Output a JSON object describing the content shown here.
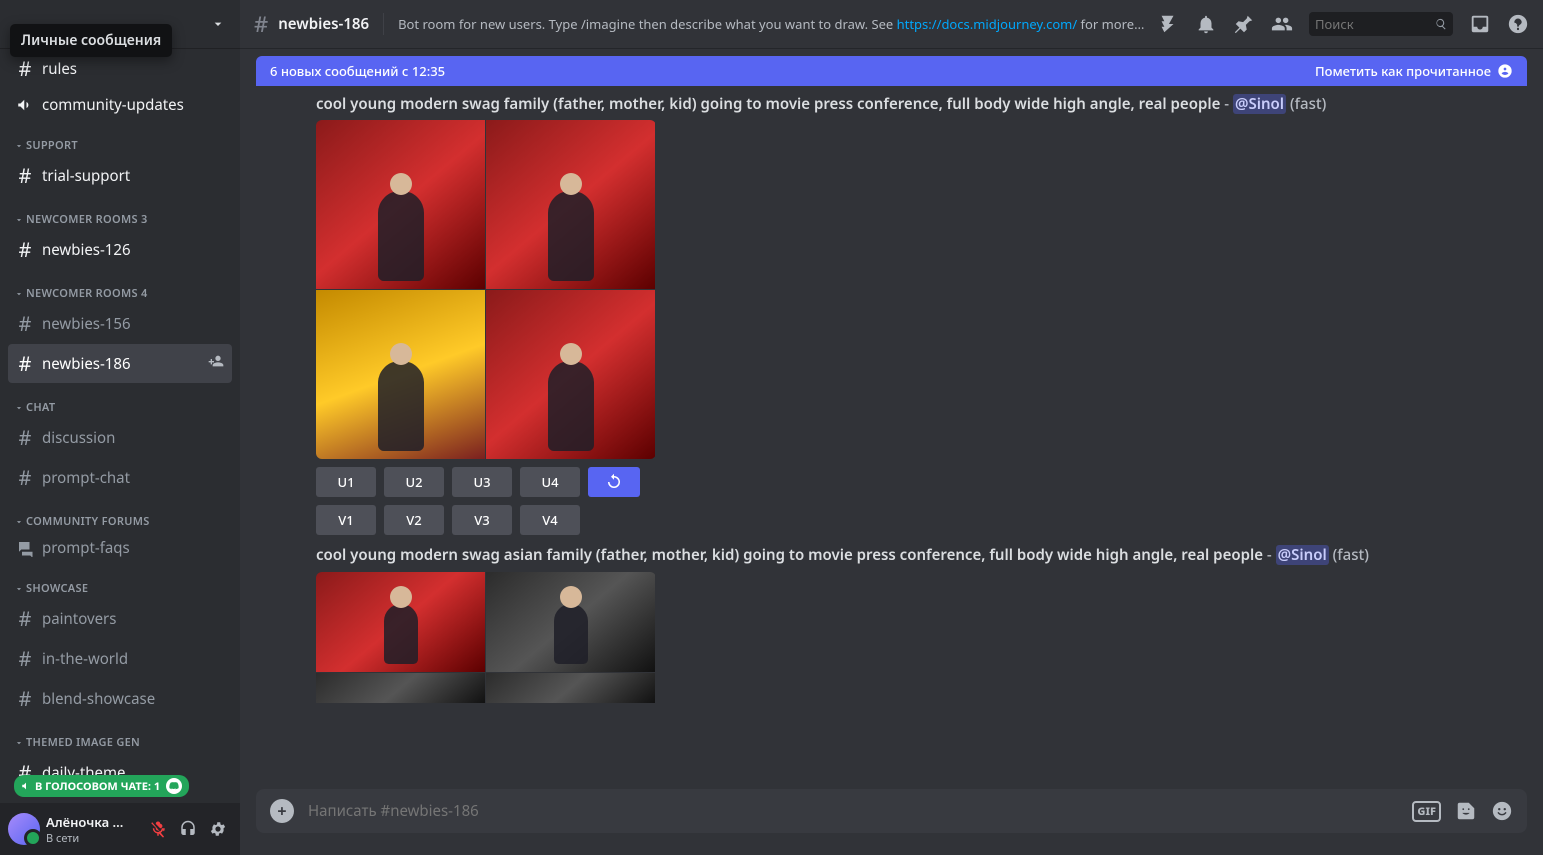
{
  "tooltip": "Личные сообщения",
  "sidebar": {
    "categories": [
      {
        "items": [
          {
            "label": "rules",
            "icon": "hash",
            "unread": true
          },
          {
            "label": "community-updates",
            "icon": "mega",
            "unread": true
          }
        ]
      },
      {
        "label": "SUPPORT",
        "items": [
          {
            "label": "trial-support",
            "icon": "hash",
            "unread": true
          }
        ]
      },
      {
        "label": "NEWCOMER ROOMS 3",
        "items": [
          {
            "label": "newbies-126",
            "icon": "hash",
            "unread": true
          }
        ]
      },
      {
        "label": "NEWCOMER ROOMS 4",
        "items": [
          {
            "label": "newbies-156",
            "icon": "hash"
          },
          {
            "label": "newbies-186",
            "icon": "hash",
            "sel": true,
            "add": true
          }
        ]
      },
      {
        "label": "CHAT",
        "items": [
          {
            "label": "discussion",
            "icon": "hash"
          },
          {
            "label": "prompt-chat",
            "icon": "hash"
          }
        ]
      },
      {
        "label": "COMMUNITY FORUMS",
        "items": [
          {
            "label": "prompt-faqs",
            "icon": "forum"
          }
        ]
      },
      {
        "label": "SHOWCASE",
        "items": [
          {
            "label": "paintovers",
            "icon": "hash"
          },
          {
            "label": "in-the-world",
            "icon": "hash"
          },
          {
            "label": "blend-showcase",
            "icon": "hash"
          }
        ]
      },
      {
        "label": "THEMED IMAGE GEN",
        "items": [
          {
            "label": "daily-theme",
            "icon": "hash",
            "unread": true
          }
        ]
      }
    ]
  },
  "voice_badge": "В ГОЛОСОВОМ ЧАТЕ: 1",
  "user": {
    "name": "Алёночка ...",
    "status": "В сети"
  },
  "header": {
    "channel": "newbies-186",
    "topic_pre": "Bot room for new users. Type /imagine then describe what you want to draw. See ",
    "topic_link": "https://docs.midjourney.com/",
    "topic_post": " for more i...",
    "search_placeholder": "Поиск"
  },
  "newbar": {
    "text": "6 новых сообщений с 12:35",
    "mark": "Пометить как прочитанное"
  },
  "messages": [
    {
      "prompt": "cool young modern swag family (father, mother, kid) going to movie press conference, full body wide high angle, real people",
      "mention": "@Sinol",
      "meta": "(fast)",
      "buttons_u": [
        "U1",
        "U2",
        "U3",
        "U4"
      ],
      "buttons_v": [
        "V1",
        "V2",
        "V3",
        "V4"
      ]
    },
    {
      "prompt": "cool young modern swag asian family (father, mother, kid) going to movie press conference, full body wide high angle, real people",
      "mention": "@Sinol",
      "meta": "(fast)"
    }
  ],
  "input_placeholder": "Написать #newbies-186",
  "gif_label": "GIF"
}
